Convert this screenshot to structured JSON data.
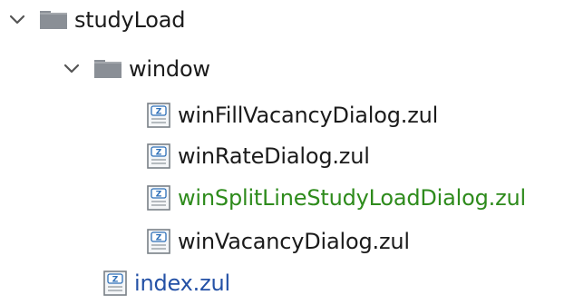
{
  "tree": {
    "root": {
      "label": "studyLoad",
      "expanded": true,
      "icon": "folder-icon"
    },
    "folder": {
      "label": "window",
      "expanded": true,
      "icon": "folder-icon"
    },
    "files": [
      {
        "label": "winFillVacancyDialog.zul",
        "icon": "zul-file-icon",
        "status": "normal"
      },
      {
        "label": "winRateDialog.zul",
        "icon": "zul-file-icon",
        "status": "normal"
      },
      {
        "label": "winSplitLineStudyLoadDialog.zul",
        "icon": "zul-file-icon",
        "status": "modified"
      },
      {
        "label": "winVacancyDialog.zul",
        "icon": "zul-file-icon",
        "status": "normal"
      }
    ],
    "index": {
      "label": "index.zul",
      "icon": "zul-file-icon",
      "status": "link"
    }
  },
  "colors": {
    "text": "#1b1b1b",
    "modified": "#2e8b1c",
    "link": "#2451a6",
    "folder": "#8a8f96"
  }
}
